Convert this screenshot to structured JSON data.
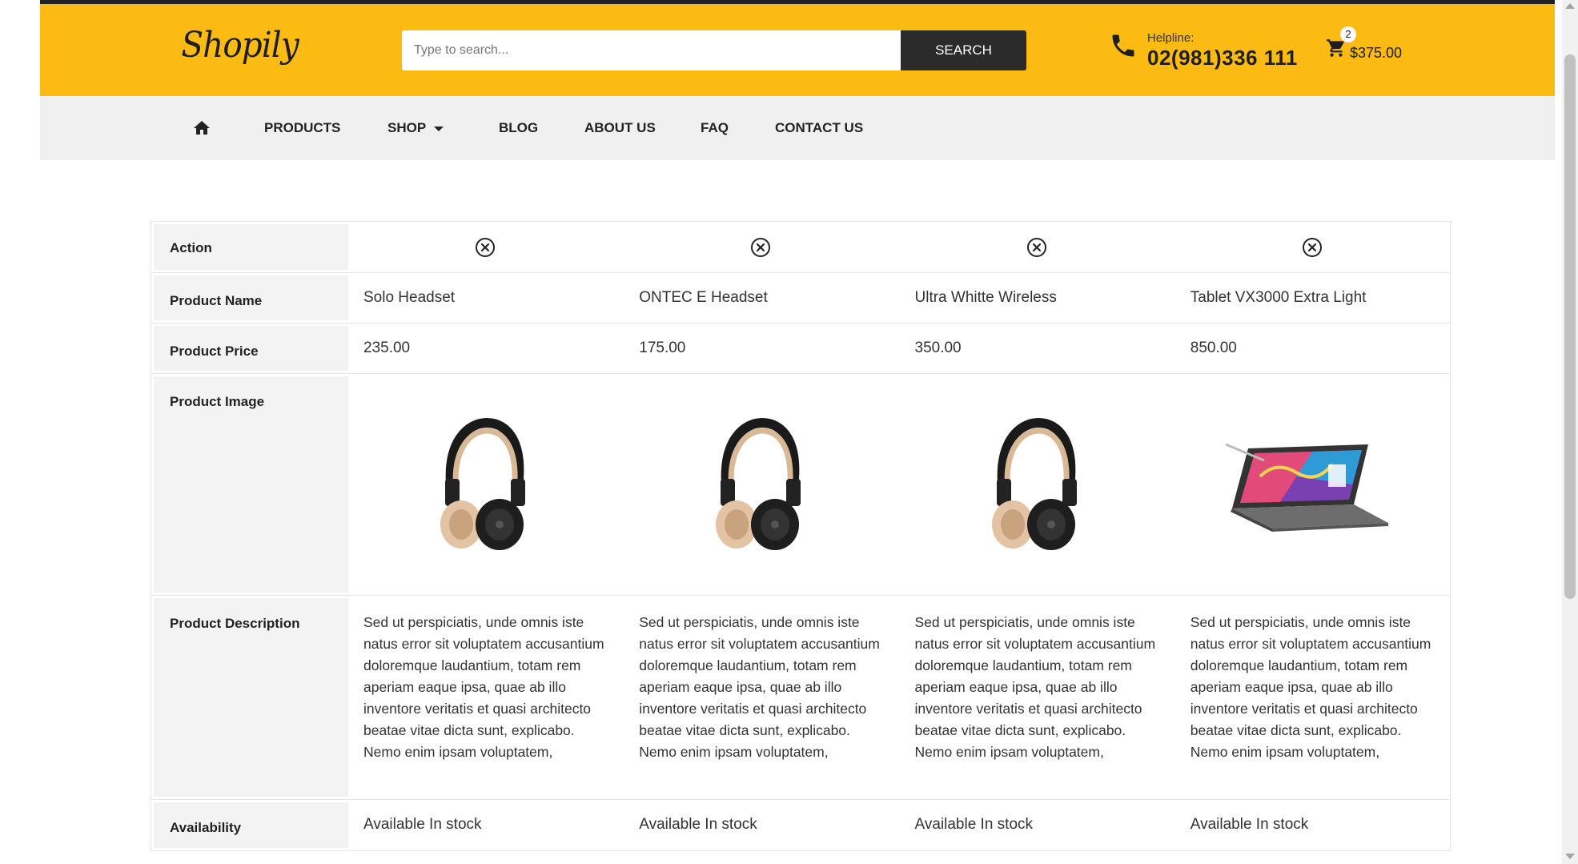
{
  "header": {
    "logo_text": "Shopily",
    "search_placeholder": "Type to search...",
    "search_button": "SEARCH",
    "helpline_label": "Helpline:",
    "helpline_number": "02(981)336 111",
    "cart_count": "2",
    "cart_total": "$375.00"
  },
  "nav": {
    "items": [
      {
        "label": "PRODUCTS"
      },
      {
        "label": "SHOP"
      },
      {
        "label": "BLOG"
      },
      {
        "label": "ABOUT US"
      },
      {
        "label": "FAQ"
      },
      {
        "label": "CONTACT US"
      }
    ]
  },
  "compare": {
    "labels": {
      "action": "Action",
      "name": "Product Name",
      "price": "Product Price",
      "image": "Product Image",
      "description": "Product Description",
      "availability": "Availability"
    },
    "products": [
      {
        "name": "Solo Headset",
        "price": "235.00",
        "image": "headphones",
        "description": "Sed ut perspiciatis, unde omnis iste natus error sit voluptatem accusantium doloremque laudantium, totam rem aperiam eaque ipsa, quae ab illo inventore veritatis et quasi architecto beatae vitae dicta sunt, explicabo. Nemo enim ipsam voluptatem,",
        "availability": "Available In stock"
      },
      {
        "name": "ONTEC E Headset",
        "price": "175.00",
        "image": "headphones",
        "description": "Sed ut perspiciatis, unde omnis iste natus error sit voluptatem accusantium doloremque laudantium, totam rem aperiam eaque ipsa, quae ab illo inventore veritatis et quasi architecto beatae vitae dicta sunt, explicabo. Nemo enim ipsam voluptatem,",
        "availability": "Available In stock"
      },
      {
        "name": "Ultra Whitte Wireless",
        "price": "350.00",
        "image": "headphones",
        "description": "Sed ut perspiciatis, unde omnis iste natus error sit voluptatem accusantium doloremque laudantium, totam rem aperiam eaque ipsa, quae ab illo inventore veritatis et quasi architecto beatae vitae dicta sunt, explicabo. Nemo enim ipsam voluptatem,",
        "availability": "Available In stock"
      },
      {
        "name": "Tablet VX3000 Extra Light",
        "price": "850.00",
        "image": "tablet-laptop",
        "description": "Sed ut perspiciatis, unde omnis iste natus error sit voluptatem accusantium doloremque laudantium, totam rem aperiam eaque ipsa, quae ab illo inventore veritatis et quasi architecto beatae vitae dicta sunt, explicabo. Nemo enim ipsam voluptatem,",
        "availability": "Available In stock"
      }
    ]
  },
  "colors": {
    "brand_yellow": "#fcbb13",
    "dark": "#2b2b2b",
    "nav_bg": "#f0f0f0"
  }
}
